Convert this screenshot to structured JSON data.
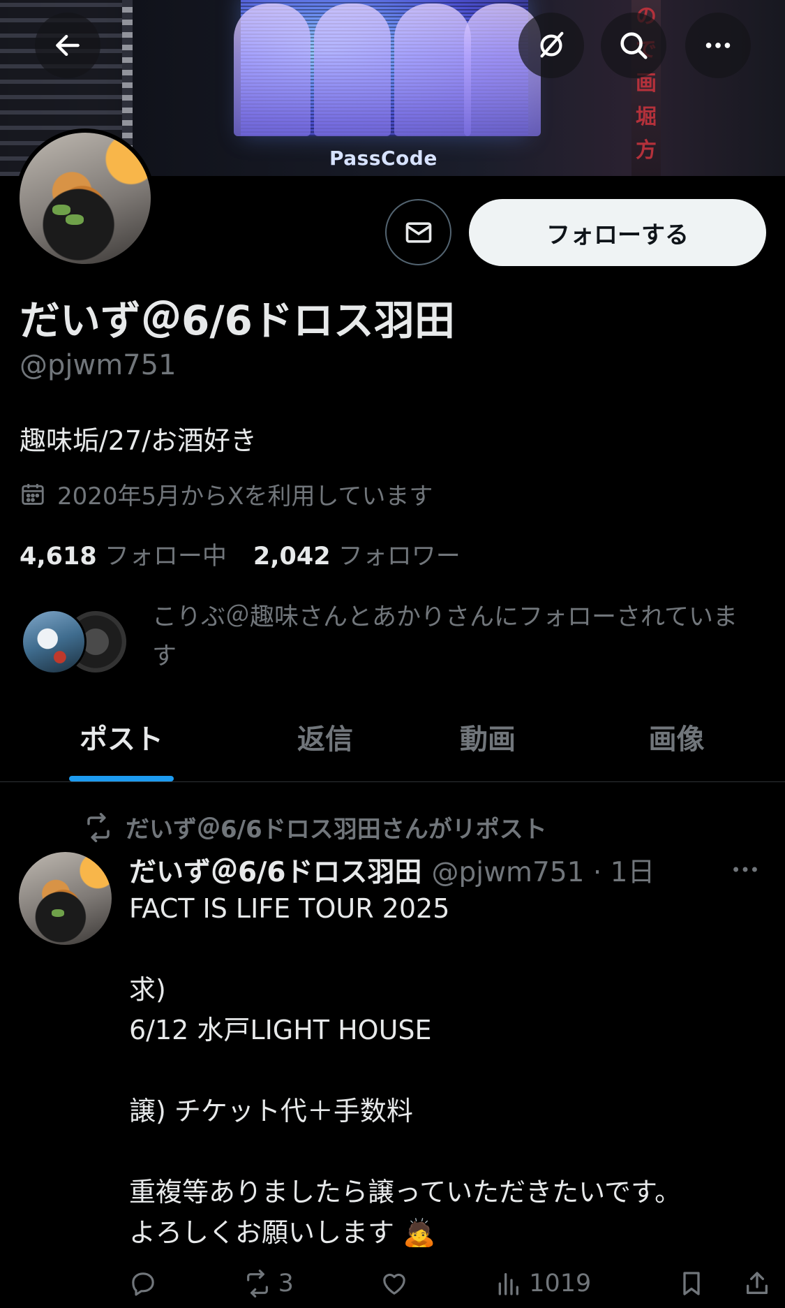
{
  "banner": {
    "text": "PassCode",
    "sign_chars": [
      "の",
      "で",
      "画",
      "堀",
      "方"
    ]
  },
  "header": {
    "back_icon": "arrow-left-icon",
    "grok_icon": "slash-circle-icon",
    "search_icon": "search-icon",
    "more_icon": "more-horizontal-icon"
  },
  "profile": {
    "display_name": "だいず＠6/6ドロス羽田",
    "handle": "@pjwm751",
    "bio": "趣味垢/27/お酒好き",
    "joined": "2020年5月からXを利用しています",
    "following_count": "4,618",
    "following_label": "フォロー中",
    "followers_count": "2,042",
    "followers_label": "フォロワー",
    "followed_by": "こりぶ＠趣味さんとあかりさんにフォローされています"
  },
  "buttons": {
    "follow_label": "フォローする",
    "message_icon": "mail-icon"
  },
  "tabs": [
    {
      "label": "ポスト",
      "active": true
    },
    {
      "label": "返信",
      "active": false
    },
    {
      "label": "動画",
      "active": false
    },
    {
      "label": "画像",
      "active": false
    }
  ],
  "post": {
    "repost_by": "だいず＠6/6ドロス羽田さんがリポスト",
    "author_name": "だいず＠6/6ドロス羽田",
    "author_handle_time": "@pjwm751 · 1日",
    "lines": [
      "FACT IS LIFE TOUR 2025",
      "",
      "求)",
      "6/12 水戸LIGHT HOUSE",
      "",
      "譲) チケット代＋手数料",
      "",
      "重複等ありましたら譲っていただきたいです。",
      "よろしくお願いします 🙇"
    ],
    "reposts": "3",
    "views": "1019"
  },
  "colors": {
    "accent": "#1d9bf0",
    "muted": "#71767b",
    "text": "#e7e9ea",
    "background": "#000000"
  }
}
